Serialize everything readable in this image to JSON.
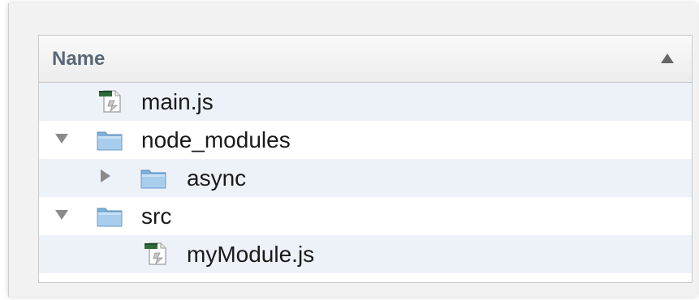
{
  "file_browser": {
    "column_header": "Name",
    "sort_direction_icon": "sort-ascending-icon",
    "items": [
      {
        "name": "main.js",
        "type": "file",
        "icon": "js-file-icon",
        "depth": 1,
        "expanded": null
      },
      {
        "name": "node_modules",
        "type": "folder",
        "icon": "folder-icon",
        "depth": 0,
        "expanded": true
      },
      {
        "name": "async",
        "type": "folder",
        "icon": "folder-icon",
        "depth": 1,
        "expanded": false
      },
      {
        "name": "src",
        "type": "folder",
        "icon": "folder-icon",
        "depth": 0,
        "expanded": true
      },
      {
        "name": "myModule.js",
        "type": "file",
        "icon": "js-file-icon",
        "depth": 2,
        "expanded": null
      }
    ]
  },
  "colors": {
    "header_text": "#5a6878",
    "alt_row": "#edf2f9",
    "folder_blue": "#9cc3e6"
  }
}
